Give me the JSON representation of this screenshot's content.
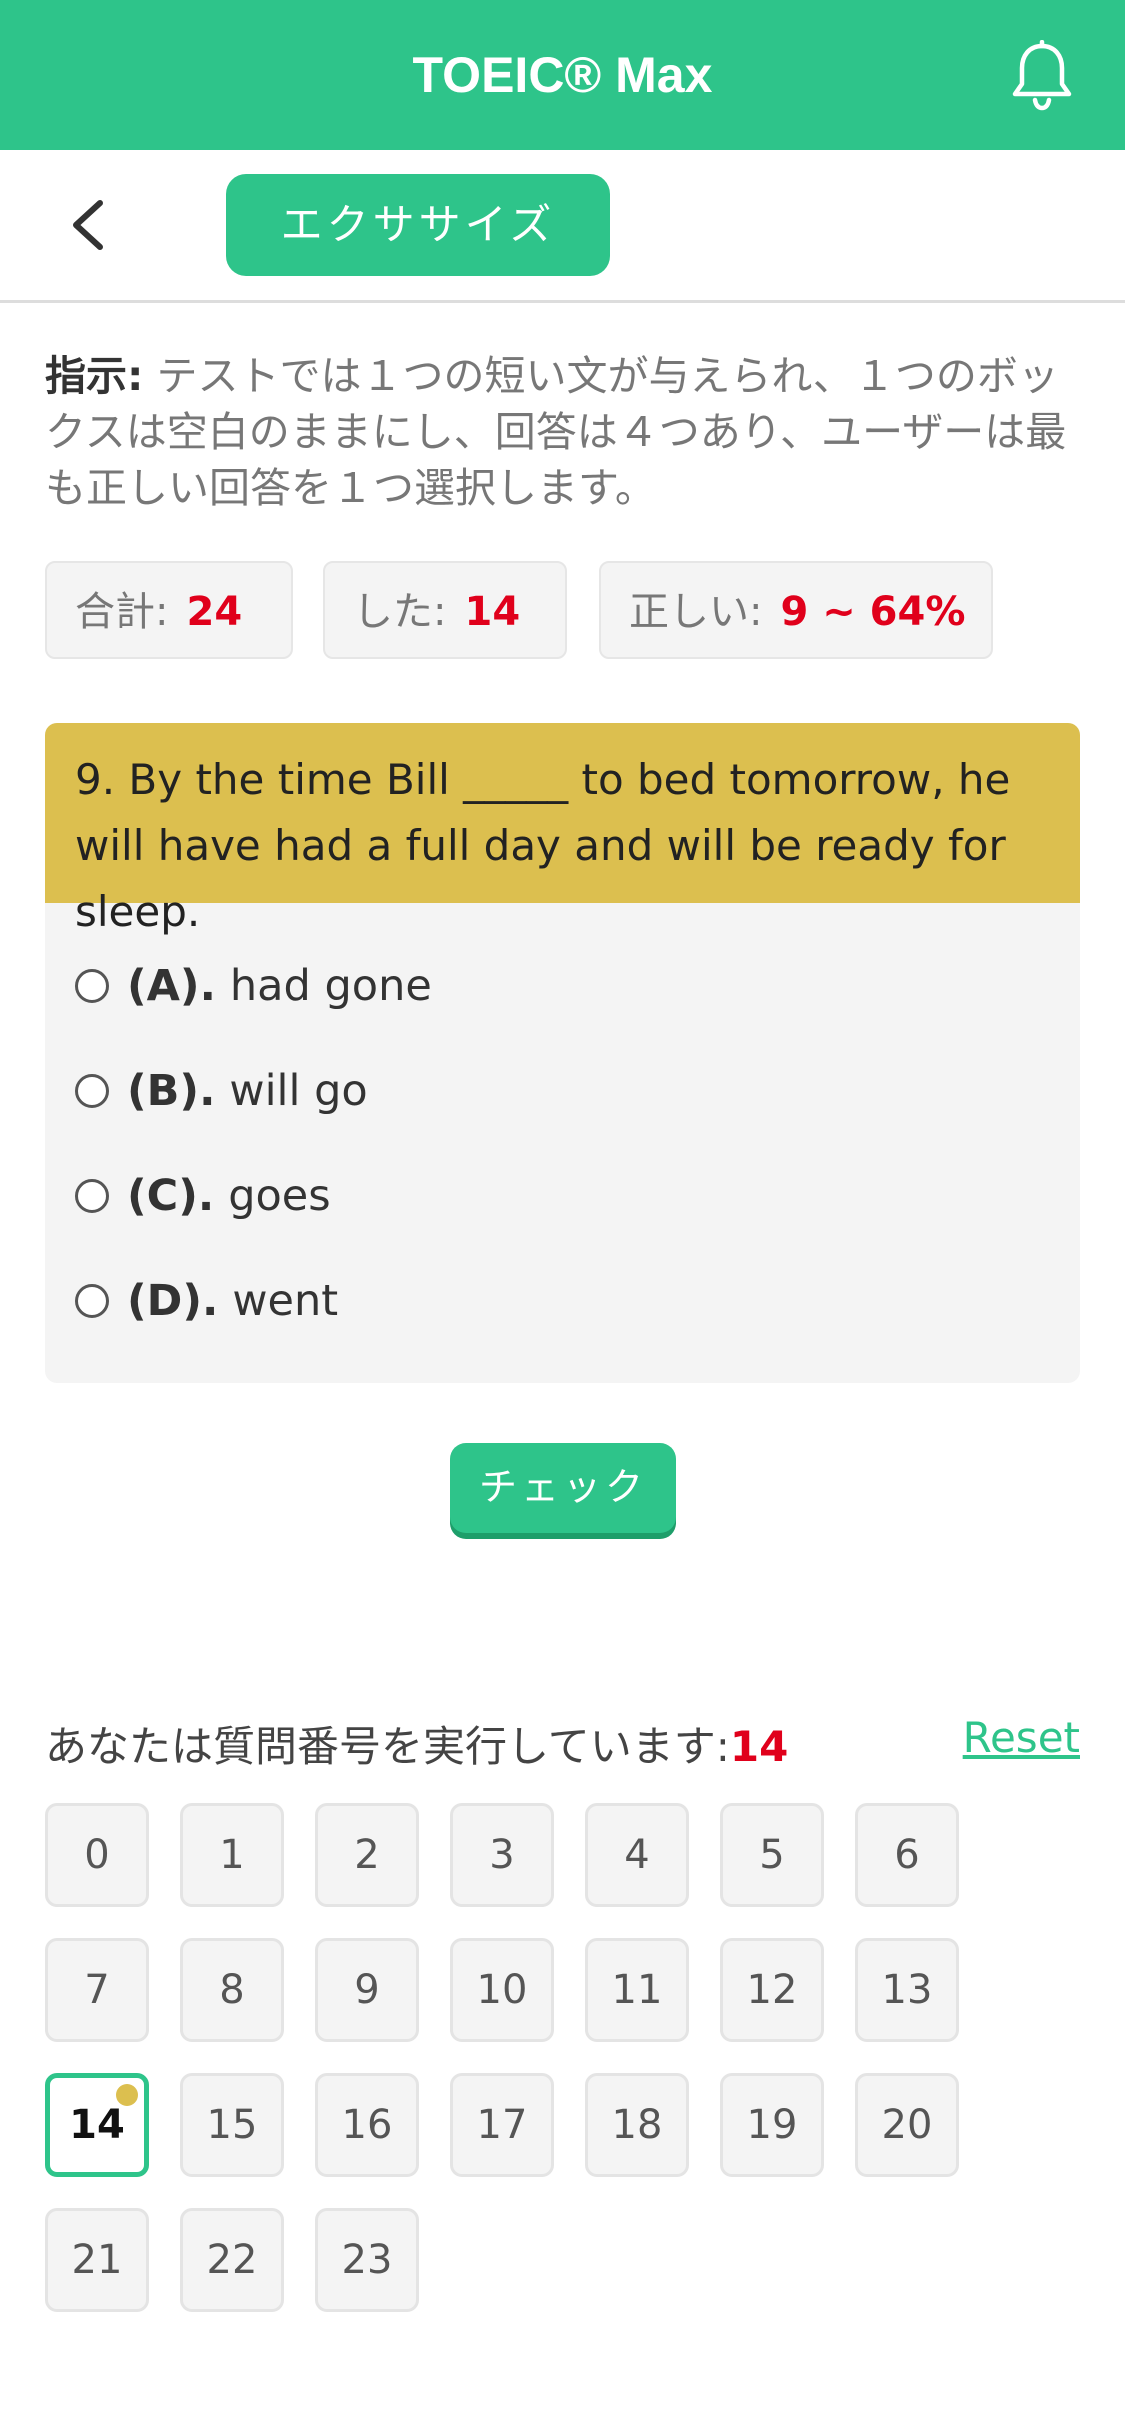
{
  "header": {
    "title": "TOEIC® Max",
    "bell_icon": "bell-icon"
  },
  "subbar": {
    "back_icon": "chevron-left-icon",
    "tab_label": "エクササイズ"
  },
  "instructions": {
    "label": "指示:",
    "text": " テストでは１つの短い文が与えられ、１つのボックスは空白のままにし、回答は４つあり、ユーザーは最も正しい回答を１つ選択します。"
  },
  "stats": {
    "total_label": "合計:",
    "total_value": "24",
    "done_label": "した:",
    "done_value": "14",
    "correct_label": "正しい:",
    "correct_value": "9 ~ 64%"
  },
  "question": {
    "text": "9. By the time Bill _____ to bed tomorrow, he will have had a full day and will be ready for sleep.",
    "options": [
      {
        "letter": "(A).",
        "text": "had gone"
      },
      {
        "letter": "(B).",
        "text": "will go"
      },
      {
        "letter": "(C).",
        "text": "goes"
      },
      {
        "letter": "(D).",
        "text": "went"
      }
    ]
  },
  "check_label": "チェック",
  "progress": {
    "label": "あなたは質問番号を実行しています:",
    "current": "14",
    "reset_label": "Reset"
  },
  "grid": {
    "numbers": [
      "0",
      "1",
      "2",
      "3",
      "4",
      "5",
      "6",
      "7",
      "8",
      "9",
      "10",
      "11",
      "12",
      "13",
      "14",
      "15",
      "16",
      "17",
      "18",
      "19",
      "20",
      "21",
      "22",
      "23"
    ],
    "current": "14"
  },
  "colors": {
    "primary": "#2ec48a",
    "question_bg": "#dcbf4f",
    "highlight_red": "#e0001b"
  }
}
